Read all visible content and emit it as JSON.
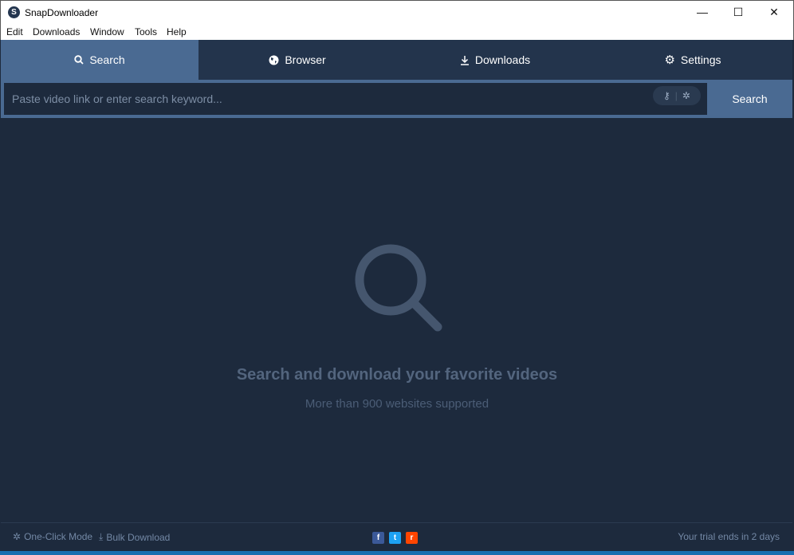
{
  "window": {
    "title": "SnapDownloader",
    "logo_letter": "S",
    "minimize": "—",
    "maximize": "☐",
    "close": "✕"
  },
  "menu": [
    "Edit",
    "Downloads",
    "Window",
    "Tools",
    "Help"
  ],
  "tabs": [
    {
      "label": "Search",
      "icon": "search-icon"
    },
    {
      "label": "Browser",
      "icon": "globe-icon"
    },
    {
      "label": "Downloads",
      "icon": "download-icon"
    },
    {
      "label": "Settings",
      "icon": "gear-icon"
    }
  ],
  "search": {
    "placeholder": "Paste video link or enter search keyword...",
    "value": "",
    "button": "Search"
  },
  "empty": {
    "title": "Search and download your favorite videos",
    "subtitle": "More than 900 websites supported"
  },
  "footer": {
    "one_click": "One-Click Mode",
    "bulk": "Bulk Download",
    "trial": "Your trial ends in 2 days",
    "social": [
      "f",
      "t",
      "r"
    ]
  },
  "colors": {
    "accent": "#4a6a92",
    "background": "#1d2a3d"
  }
}
